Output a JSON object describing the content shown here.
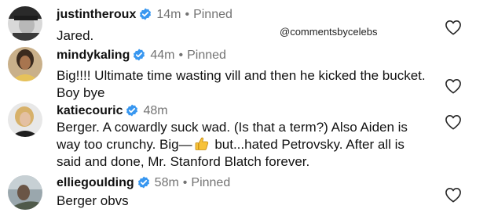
{
  "watermark": "@commentsbycelebѕ",
  "comments": [
    {
      "username": "justintheroux",
      "time": "14m",
      "separator": "•",
      "pinned": "Pinned",
      "text": "Jared."
    },
    {
      "username": "mindykaling",
      "time": "44m",
      "separator": "•",
      "pinned": "Pinned",
      "text": "Big!!!! Ultimate time wasting vill and then he kicked the bucket. Boy bye"
    },
    {
      "username": "katiecouric",
      "time": "48m",
      "text_before_emoji": "Berger. A cowardly suck wad. (Is that a term?) Also Aiden is way too crunchy. Big—",
      "emoji": "thumbs-up",
      "text_after_emoji": " but...hated Petrovsky. After all is said and done, Mr. Stanford Blatch forever."
    },
    {
      "username": "elliegoulding",
      "time": "58m",
      "separator": "•",
      "pinned": "Pinned",
      "text": "Berger obvs"
    }
  ],
  "colors": {
    "verified_badge": "#3897f0",
    "secondary_text": "#737373"
  },
  "icons": {
    "verified": "verified-badge-icon",
    "like": "heart-outline-icon"
  }
}
